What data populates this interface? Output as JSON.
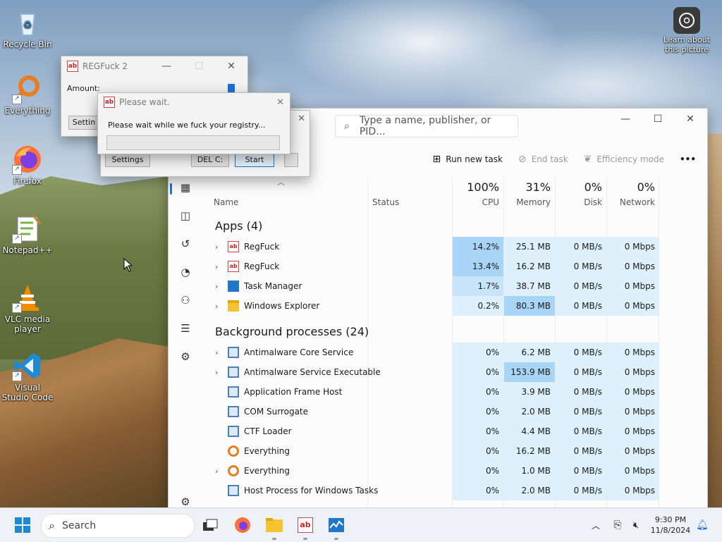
{
  "desktop": {
    "icons": [
      {
        "label": "Recycle Bin",
        "icon": "recycle-bin-icon"
      },
      {
        "label": "Everything",
        "icon": "everything-icon"
      },
      {
        "label": "Firefox",
        "icon": "firefox-icon"
      },
      {
        "label": "Notepad++",
        "icon": "notepad-plus-plus-icon"
      },
      {
        "label": "VLC media player",
        "icon": "vlc-icon"
      },
      {
        "label": "Visual Studio Code",
        "icon": "vscode-icon"
      }
    ],
    "learn": {
      "label": "Learn about this picture",
      "icon": "camera-icon"
    }
  },
  "regfuck_main": {
    "title": "REGFuck 2",
    "amount_label": "Amount:",
    "settings_label": "Settin"
  },
  "regfuck_back": {
    "settings_label": "Settings",
    "delc_label": "DEL C:",
    "start_label": "Start"
  },
  "wait_dialog": {
    "title": "Please wait.",
    "message": "Please wait while we fuck your registry...",
    "close": "✕"
  },
  "taskmgr": {
    "search_placeholder": "Type a name, publisher, or PID...",
    "toolbar": {
      "run_new_task": "Run new task",
      "end_task": "End task",
      "efficiency_mode": "Efficiency mode",
      "more": "•••"
    },
    "columns": {
      "name": "Name",
      "status": "Status",
      "cpu_pct": "100%",
      "cpu": "CPU",
      "mem_pct": "31%",
      "mem": "Memory",
      "disk_pct": "0%",
      "disk": "Disk",
      "net_pct": "0%",
      "net": "Network"
    },
    "apps_header": "Apps (4)",
    "apps": [
      {
        "name": "RegFuck",
        "icon": "regfuck-icon",
        "expand": true,
        "cpu": "14.2%",
        "mem": "25.1 MB",
        "disk": "0 MB/s",
        "net": "0 Mbps"
      },
      {
        "name": "RegFuck",
        "icon": "regfuck-icon",
        "expand": true,
        "cpu": "13.4%",
        "mem": "16.2 MB",
        "disk": "0 MB/s",
        "net": "0 Mbps"
      },
      {
        "name": "Task Manager",
        "icon": "task-manager-icon",
        "expand": true,
        "cpu": "1.7%",
        "mem": "38.7 MB",
        "disk": "0 MB/s",
        "net": "0 Mbps"
      },
      {
        "name": "Windows Explorer",
        "icon": "folder-icon",
        "expand": true,
        "cpu": "0.2%",
        "mem": "80.3 MB",
        "disk": "0 MB/s",
        "net": "0 Mbps"
      }
    ],
    "bg_header": "Background processes (24)",
    "background": [
      {
        "name": "Antimalware Core Service",
        "icon": "system-process-icon",
        "expand": true,
        "cpu": "0%",
        "mem": "6.2 MB",
        "disk": "0 MB/s",
        "net": "0 Mbps"
      },
      {
        "name": "Antimalware Service Executable",
        "icon": "system-process-icon",
        "expand": true,
        "cpu": "0%",
        "mem": "153.9 MB",
        "disk": "0 MB/s",
        "net": "0 Mbps"
      },
      {
        "name": "Application Frame Host",
        "icon": "system-process-icon",
        "expand": false,
        "cpu": "0%",
        "mem": "3.9 MB",
        "disk": "0 MB/s",
        "net": "0 Mbps"
      },
      {
        "name": "COM Surrogate",
        "icon": "system-process-icon",
        "expand": false,
        "cpu": "0%",
        "mem": "2.0 MB",
        "disk": "0 MB/s",
        "net": "0 Mbps"
      },
      {
        "name": "CTF Loader",
        "icon": "system-process-icon",
        "expand": false,
        "cpu": "0%",
        "mem": "4.4 MB",
        "disk": "0 MB/s",
        "net": "0 Mbps"
      },
      {
        "name": "Everything",
        "icon": "everything-icon",
        "expand": false,
        "cpu": "0%",
        "mem": "16.2 MB",
        "disk": "0 MB/s",
        "net": "0 Mbps"
      },
      {
        "name": "Everything",
        "icon": "everything-icon",
        "expand": true,
        "cpu": "0%",
        "mem": "1.0 MB",
        "disk": "0 MB/s",
        "net": "0 Mbps"
      },
      {
        "name": "Host Process for Windows Tasks",
        "icon": "system-process-icon",
        "expand": false,
        "cpu": "0%",
        "mem": "2.0 MB",
        "disk": "0 MB/s",
        "net": "0 Mbps"
      }
    ]
  },
  "taskbar": {
    "search_label": "Search",
    "time": "9:30 PM",
    "date": "11/8/2024"
  },
  "colors": {
    "cpu_hot": "#a8d4f5",
    "cpu_warm": "#c7e4f8",
    "cpu_cool": "#def0fb",
    "accent": "#1f6feb"
  }
}
